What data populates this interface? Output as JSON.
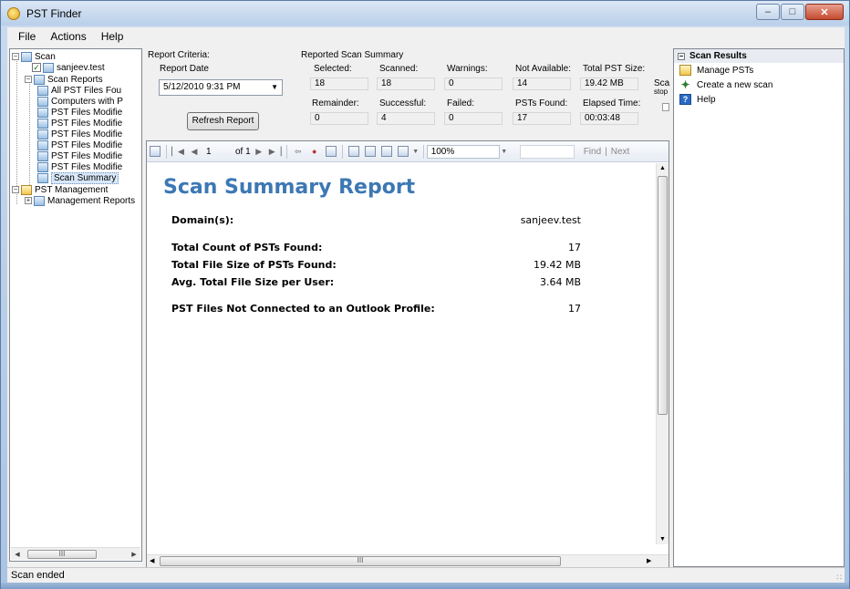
{
  "window": {
    "title": "PST Finder"
  },
  "menu": [
    "File",
    "Actions",
    "Help"
  ],
  "tree": {
    "scan": "Scan",
    "domain": "sanjeev.test",
    "scan_reports": "Scan Reports",
    "reports": [
      "All PST Files Fou",
      "Computers with P",
      "PST Files Modifie",
      "PST Files Modifie",
      "PST Files Modifie",
      "PST Files Modifie",
      "PST Files Modifie",
      "PST Files Modifie"
    ],
    "scan_summary": "Scan Summary",
    "pst_management": "PST Management",
    "management_reports": "Management Reports",
    "scroll_glyph": "III"
  },
  "criteria": {
    "group_label": "Report Criteria:",
    "report_date_label": "Report Date",
    "report_date_value": "5/12/2010 9:31 PM",
    "refresh_button": "Refresh Report"
  },
  "summary": {
    "group_label": "Reported Scan Summary",
    "selected_label": "Selected:",
    "selected": "18",
    "scanned_label": "Scanned:",
    "scanned": "18",
    "warnings_label": "Warnings:",
    "warnings": "0",
    "not_available_label": "Not Available:",
    "not_available": "14",
    "total_size_label": "Total PST Size:",
    "total_size": "19.42 MB",
    "remainder_label": "Remainder:",
    "remainder": "0",
    "successful_label": "Successful:",
    "successful": "4",
    "failed_label": "Failed:",
    "failed": "0",
    "psts_found_label": "PSTs Found:",
    "psts_found": "17",
    "elapsed_label": "Elapsed Time:",
    "elapsed": "00:03:48",
    "cut_label_1": "Sca",
    "cut_label_2": "stop"
  },
  "toolbar": {
    "page_current": "1",
    "page_of": "of 1",
    "zoom": "100%",
    "find": "Find",
    "next": "Next"
  },
  "report": {
    "title": "Scan Summary Report",
    "rows": [
      {
        "label": "Domain(s):",
        "value": "sanjeev.test"
      },
      {
        "label": "Total Count of PSTs Found:",
        "value": "17"
      },
      {
        "label": "Total File Size of PSTs Found:",
        "value": "19.42 MB"
      },
      {
        "label": "Avg. Total File Size per User:",
        "value": "3.64 MB"
      },
      {
        "label": "PST Files Not Connected to an Outlook Profile:",
        "value": "17"
      }
    ],
    "scroll_glyph": "III"
  },
  "tasks": {
    "header": "Scan Results",
    "items": [
      "Manage PSTs",
      "Create a new scan",
      "Help"
    ]
  },
  "status": {
    "text": "Scan ended"
  },
  "colors": {
    "title_blue": "#3c78b4",
    "selection": "#d9e8f9"
  }
}
